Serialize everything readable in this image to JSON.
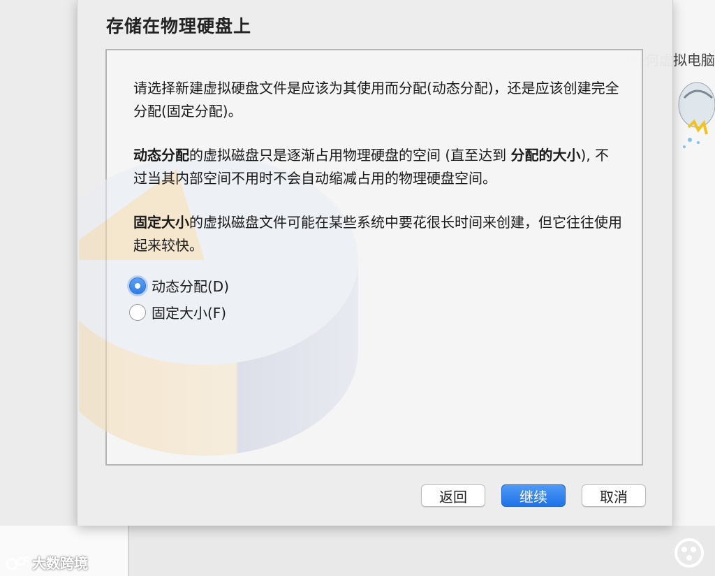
{
  "dialog": {
    "title": "存储在物理硬盘上",
    "paragraph1": "请选择新建虚拟硬盘文件是应该为其使用而分配(动态分配)，还是应该创建完全分配(固定分配)。",
    "paragraph2_bold1": "动态分配",
    "paragraph2_mid": "的虚拟磁盘只是逐渐占用物理硬盘的空间 (直至达到 ",
    "paragraph2_bold2": "分配的大小",
    "paragraph2_end": "), 不过当其内部空间不用时不会自动缩减占用的物理硬盘空间。",
    "paragraph3_bold": "固定大小",
    "paragraph3_rest": "的虚拟磁盘文件可能在某些系统中要花很长时间来创建，但它往往使用起来较快。",
    "options": [
      {
        "label": "动态分配(D)",
        "checked": true
      },
      {
        "label": "固定大小(F)",
        "checked": false
      }
    ],
    "buttons": {
      "back": "返回",
      "continue": "继续",
      "cancel": "取消"
    }
  },
  "background": {
    "right_text": "!任何虚拟电脑"
  },
  "watermark": {
    "text": "大数跨境"
  },
  "colors": {
    "accent": "#2f7ee8"
  }
}
